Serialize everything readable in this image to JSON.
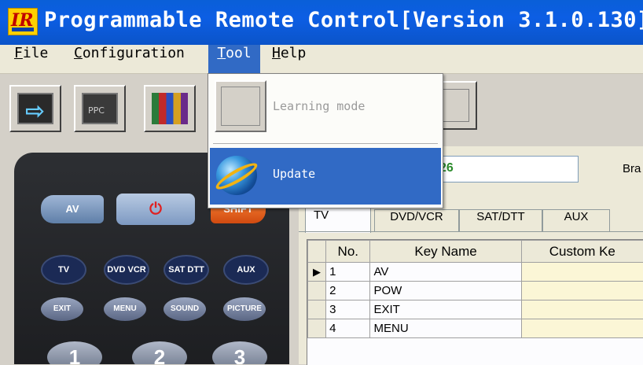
{
  "window": {
    "title": "Programmable Remote Control[Version 3.1.0.130]",
    "icon_text": "IR"
  },
  "menubar": {
    "file": {
      "accel": "F",
      "rest": "ile"
    },
    "configuration": {
      "accel": "C",
      "rest": "onfiguration"
    },
    "tool": {
      "accel": "T",
      "rest": "ool"
    },
    "help": {
      "accel": "H",
      "rest": "elp"
    }
  },
  "toolbar": {
    "ppc_label": "PPC",
    "arrow_glyph": "⇨"
  },
  "tool_menu": {
    "learning_mode": "Learning mode",
    "update": "Update"
  },
  "code_field": {
    "value": "26"
  },
  "brand_label": "Bra",
  "remote_buttons": {
    "av": "AV",
    "power": "⏻",
    "shift": "SHIFT",
    "tv": "TV",
    "dvd": "DVD VCR",
    "sat": "SAT DTT",
    "aux": "AUX",
    "exit": "EXIT",
    "menu": "MENU",
    "sound": "SOUND",
    "picture": "PICTURE",
    "n1": "1",
    "n2": "2",
    "n3": "3"
  },
  "tabs": [
    "TV",
    "DVD/VCR",
    "SAT/DTT",
    "AUX"
  ],
  "grid": {
    "headers": {
      "no": "No.",
      "key_name": "Key Name",
      "custom": "Custom Ke"
    },
    "rows": [
      {
        "no": "1",
        "key": "AV",
        "indicator": "▶"
      },
      {
        "no": "2",
        "key": "POW",
        "indicator": ""
      },
      {
        "no": "3",
        "key": "EXIT",
        "indicator": ""
      },
      {
        "no": "4",
        "key": "MENU",
        "indicator": ""
      }
    ]
  }
}
